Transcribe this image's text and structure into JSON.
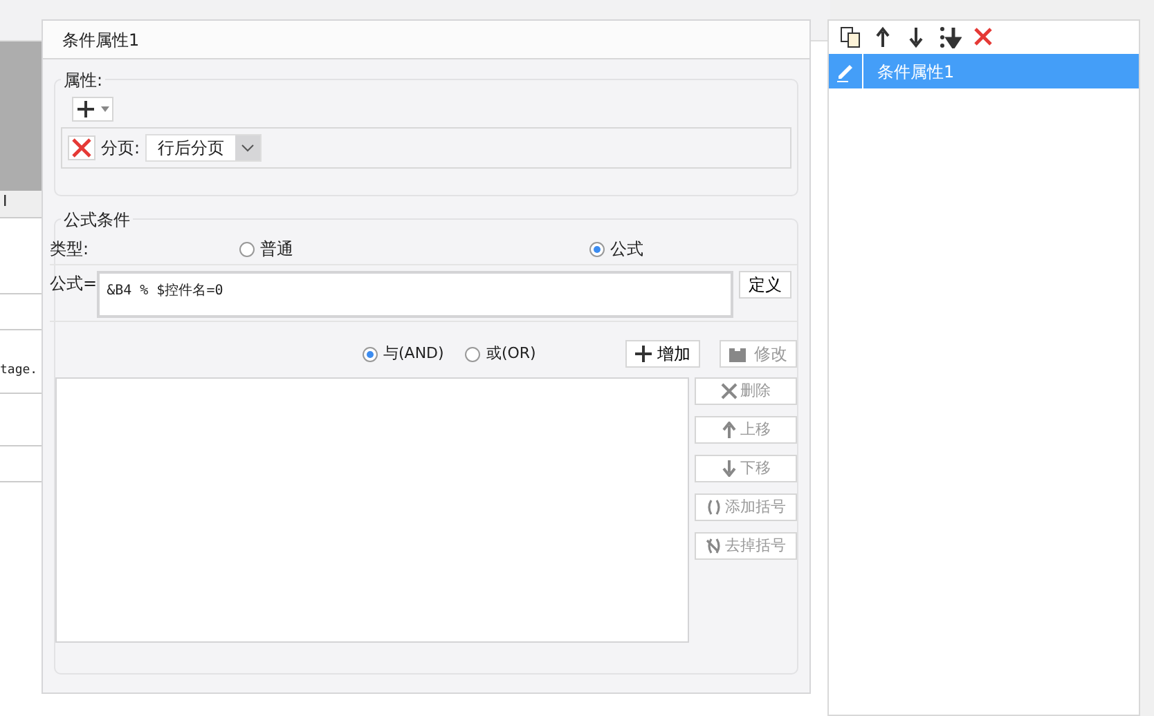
{
  "background": {
    "column_header": "I",
    "cell_text": "tage."
  },
  "dialog": {
    "title": "条件属性1",
    "properties": {
      "legend": "属性:",
      "page_break_label": "分页:",
      "page_break_value": "行后分页"
    },
    "formula_condition": {
      "legend": "公式条件",
      "type_label": "类型:",
      "types": [
        {
          "label": "普通",
          "selected": false
        },
        {
          "label": "公式",
          "selected": true
        }
      ],
      "formula_label": "公式=",
      "formula": "&B4 % $控件名=0",
      "define_button": "定义",
      "joins": [
        {
          "label": "与(AND)",
          "selected": true
        },
        {
          "label": "或(OR)",
          "selected": false
        }
      ],
      "add_button": {
        "label": "增加",
        "disabled": false
      },
      "modify_button": {
        "label": "修改",
        "disabled": true
      },
      "side_buttons": [
        {
          "kind": "delete",
          "label": "删除",
          "disabled": true
        },
        {
          "kind": "up",
          "label": "上移",
          "disabled": true
        },
        {
          "kind": "down",
          "label": "下移",
          "disabled": true
        },
        {
          "kind": "add-parens",
          "label": "添加括号",
          "disabled": true
        },
        {
          "kind": "remove-parens",
          "label": "去掉括号",
          "disabled": true
        }
      ]
    }
  },
  "conditions": {
    "items": [
      {
        "label": "条件属性1",
        "selected": true
      }
    ]
  }
}
